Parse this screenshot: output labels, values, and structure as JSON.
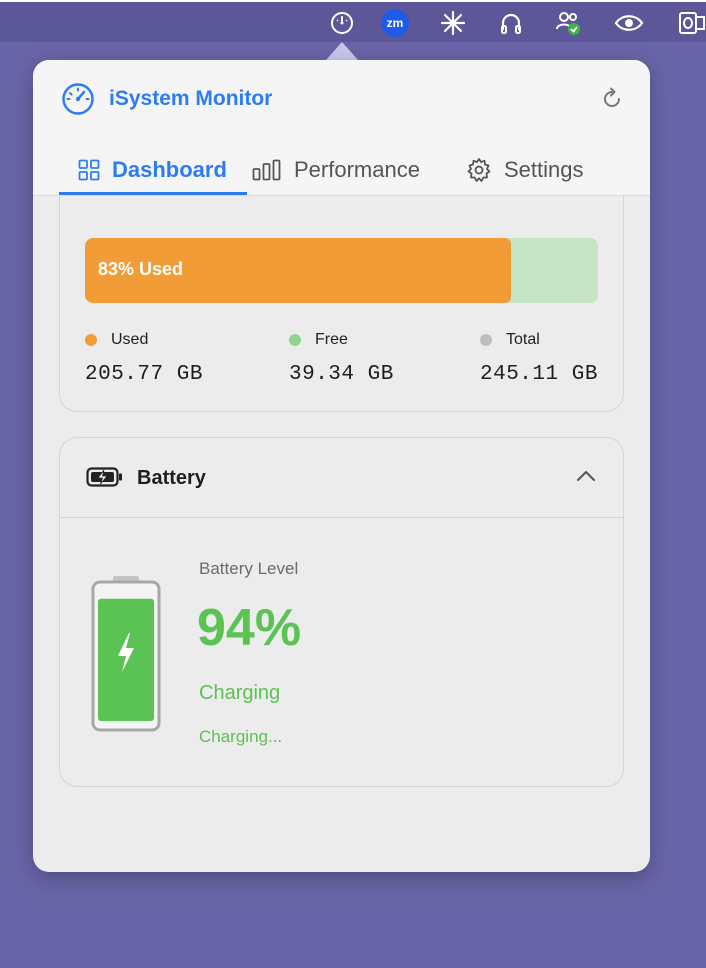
{
  "menubar": {
    "icons": [
      "speedometer-icon",
      "zoom-icon",
      "sparkle-icon",
      "headphones-icon",
      "teams-icon",
      "eye-icon",
      "outlook-icon"
    ],
    "zoom_text": "zm"
  },
  "app": {
    "title": "iSystem Monitor",
    "accent": "#2d7df2"
  },
  "tabs": [
    {
      "label": "Dashboard",
      "icon": "grid-icon",
      "active": true
    },
    {
      "label": "Performance",
      "icon": "bars-icon",
      "active": false
    },
    {
      "label": "Settings",
      "icon": "gear-icon",
      "active": false
    }
  ],
  "storage": {
    "used_percent": 83,
    "bar_label": "83% Used",
    "used_color": "#f29c38",
    "free_color": "#8fd48a",
    "total_color": "#bdbdbd",
    "legend": [
      {
        "label": "Used",
        "value": "205.77 GB"
      },
      {
        "label": "Free",
        "value": "39.34 GB"
      },
      {
        "label": "Total",
        "value": "245.11 GB"
      }
    ]
  },
  "battery": {
    "title": "Battery",
    "level_label": "Battery Level",
    "percent": "94%",
    "percent_value": 94,
    "state": "Charging",
    "sub_state": "Charging...",
    "color": "#5bc254"
  }
}
